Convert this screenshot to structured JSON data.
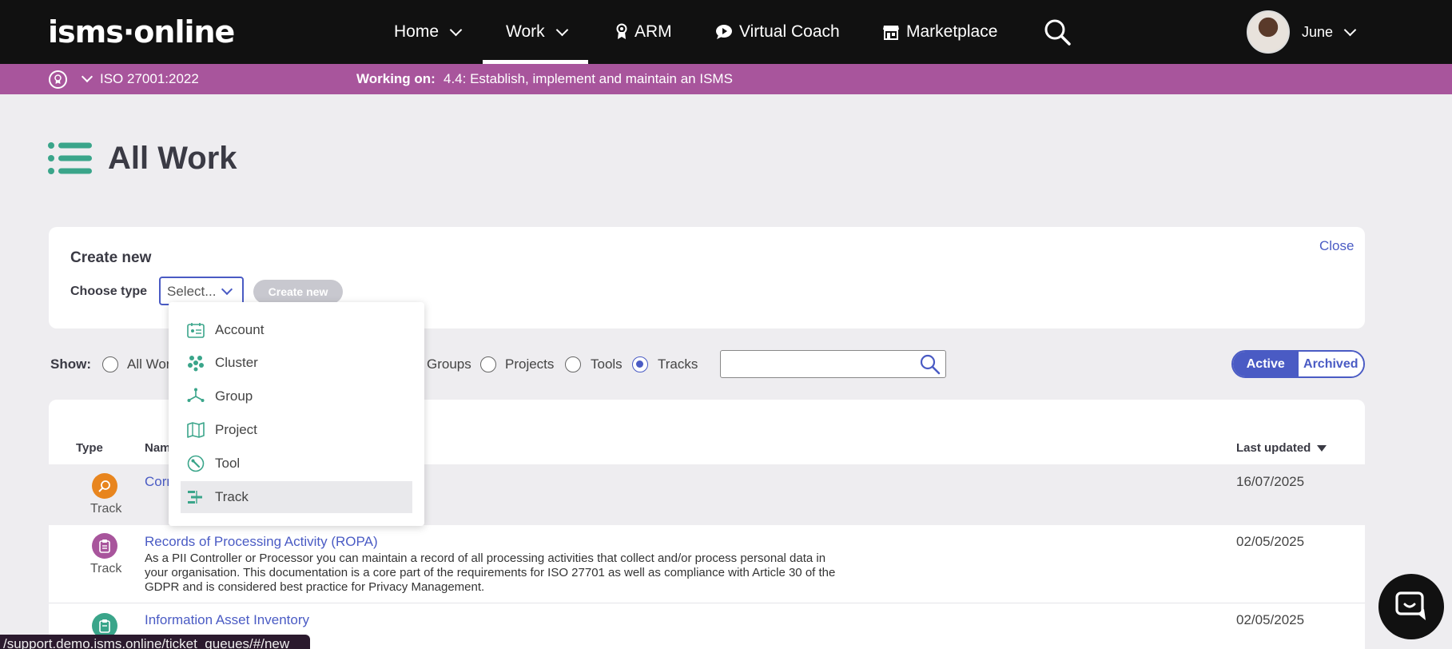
{
  "nav": {
    "logo": "isms·online",
    "home": "Home",
    "work": "Work",
    "arm": "ARM",
    "virtual_coach": "Virtual Coach",
    "marketplace": "Marketplace",
    "user": "June"
  },
  "context": {
    "standard": "ISO 27001:2022",
    "working_on_label": "Working on:",
    "working_on_task": "4.4: Establish, implement and maintain an ISMS"
  },
  "page": {
    "title": "All Work"
  },
  "create": {
    "title": "Create new",
    "close": "Close",
    "choose_type_label": "Choose type",
    "select_value": "Select...",
    "create_button": "Create new",
    "options": [
      "Account",
      "Cluster",
      "Group",
      "Project",
      "Tool",
      "Track"
    ],
    "highlighted_option": "Track"
  },
  "filter": {
    "show_label": "Show:",
    "options": [
      "All Wor",
      "Groups",
      "Projects",
      "Tools",
      "Tracks"
    ],
    "selected": "Tracks",
    "active": "Active",
    "archived": "Archived",
    "search_value": ""
  },
  "table": {
    "headers": {
      "type": "Type",
      "name": "Nam",
      "last_updated": "Last updated"
    },
    "rows": [
      {
        "type": "Track",
        "name": "Corr",
        "description": "",
        "date": "16/07/2025",
        "color": "#e8851e"
      },
      {
        "type": "Track",
        "name": "Records of Processing Activity (ROPA)",
        "description": "As a PII Controller or Processor you can maintain a record of all processing activities that collect and/or process personal data in your organisation. This documentation is a core part of the requirements for ISO 27701 as well as compliance with Article 30 of the GDPR and is considered best practice for Privacy Management.",
        "date": "02/05/2025",
        "color": "#a8559c"
      },
      {
        "type": "",
        "name": "Information Asset Inventory",
        "description": "",
        "date": "02/05/2025",
        "color": "#3aa58a"
      }
    ]
  },
  "status_url": "/support.demo.isms.online/ticket_queues/#/new",
  "colors": {
    "accent": "#4a5bc4",
    "context_bar": "#a8559c",
    "teal_icon": "#3aa58a"
  }
}
